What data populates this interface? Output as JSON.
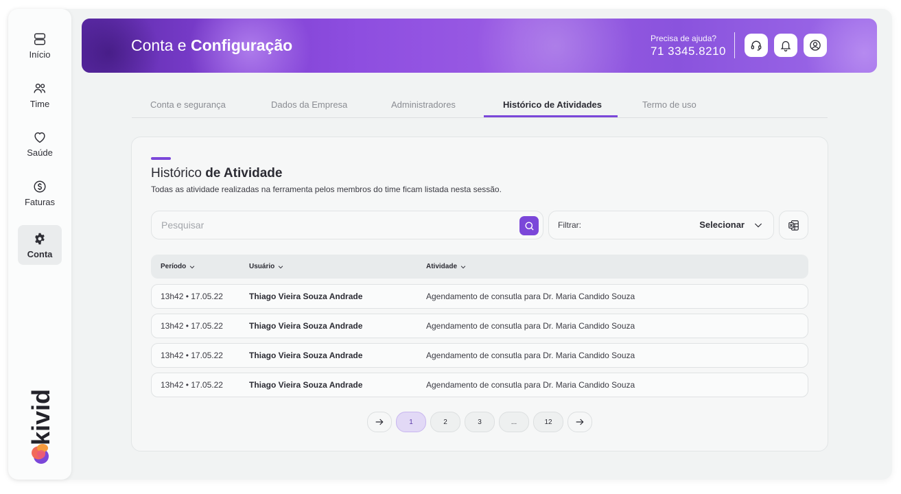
{
  "sidebar": {
    "items": [
      {
        "label": "Início",
        "icon": "home-icon"
      },
      {
        "label": "Time",
        "icon": "team-icon"
      },
      {
        "label": "Saúde",
        "icon": "heart-icon"
      },
      {
        "label": "Faturas",
        "icon": "dollar-icon"
      },
      {
        "label": "Conta",
        "icon": "gear-icon",
        "active": true
      }
    ],
    "logo_text": "kivid"
  },
  "header": {
    "title_light": "Conta e ",
    "title_bold": "Configuração",
    "help_question": "Precisa de ajuda?",
    "help_phone": "71 3345.8210",
    "icons": [
      "headset-icon",
      "bell-icon",
      "user-icon"
    ]
  },
  "tabs": [
    {
      "label": "Conta e segurança"
    },
    {
      "label": "Dados da Empresa"
    },
    {
      "label": "Administradores"
    },
    {
      "label": "Histórico de Atividades",
      "active": true
    },
    {
      "label": "Termo de uso"
    }
  ],
  "card": {
    "title_light": "Histórico ",
    "title_bold": "de Atividade",
    "subtitle": "Todas as atividade realizadas na ferramenta pelos membros do time ficam listada nesta sessão."
  },
  "search": {
    "placeholder": "Pesquisar",
    "value": ""
  },
  "filter": {
    "label": "Filtrar:",
    "value": "Selecionar"
  },
  "table": {
    "headers": [
      "Período",
      "Usuário",
      "Atividade"
    ],
    "rows": [
      {
        "periodo": "13h42 • 17.05.22",
        "usuario": "Thiago Vieira Souza Andrade",
        "atividade": "Agendamento de consutla para Dr. Maria Candido Souza"
      },
      {
        "periodo": "13h42 • 17.05.22",
        "usuario": "Thiago Vieira Souza Andrade",
        "atividade": "Agendamento de consutla para Dr. Maria Candido Souza"
      },
      {
        "periodo": "13h42 • 17.05.22",
        "usuario": "Thiago Vieira Souza Andrade",
        "atividade": "Agendamento de consutla para Dr. Maria Candido Souza"
      },
      {
        "periodo": "13h42 • 17.05.22",
        "usuario": "Thiago Vieira Souza Andrade",
        "atividade": "Agendamento de consutla para Dr. Maria Candido Souza"
      }
    ]
  },
  "pagination": {
    "pages": [
      "1",
      "2",
      "3",
      "...",
      "12"
    ],
    "current": "1"
  },
  "colors": {
    "accent": "#7b47d9",
    "header_gradient_start": "#5b2aa6",
    "header_gradient_end": "#9d6ae9"
  }
}
